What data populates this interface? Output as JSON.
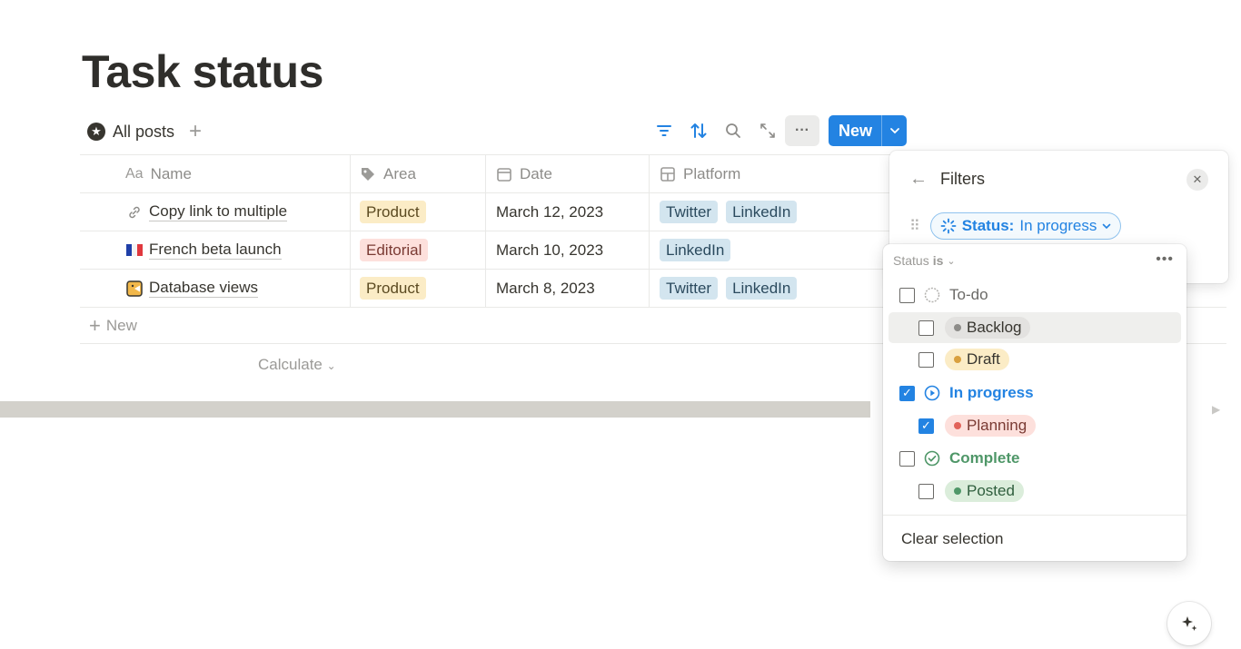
{
  "page": {
    "title": "Task status"
  },
  "view": {
    "tab_label": "All posts",
    "add_label": "+"
  },
  "toolbar": {
    "new_label": "New",
    "more_label": "···"
  },
  "table": {
    "columns": [
      {
        "icon": "text-type-icon",
        "icon_text": "Aa",
        "label": "Name"
      },
      {
        "icon": "tag-icon",
        "label": "Area"
      },
      {
        "icon": "calendar-icon",
        "label": "Date"
      },
      {
        "icon": "multi-select-icon",
        "label": "Platform"
      }
    ],
    "rows": [
      {
        "icon": "link-icon",
        "name": "Copy link to multiple",
        "area": "Product",
        "date": "March 12, 2023",
        "platforms": [
          "Twitter",
          "LinkedIn"
        ]
      },
      {
        "icon": "france-flag-icon",
        "name": "French beta launch",
        "area": "Editorial",
        "date": "March 10, 2023",
        "platforms": [
          "LinkedIn"
        ]
      },
      {
        "icon": "pacman-icon",
        "name": "Database views",
        "area": "Product",
        "date": "March 8, 2023",
        "platforms": [
          "Twitter",
          "LinkedIn"
        ]
      }
    ],
    "new_row_label": "New",
    "calculate_label": "Calculate"
  },
  "filters": {
    "title": "Filters",
    "chip_property": "Status:",
    "chip_value": "In progress"
  },
  "status_menu": {
    "header_property": "Status",
    "header_operator": "is",
    "groups": [
      {
        "label": "To-do",
        "checked": false,
        "color": "#6b6a67",
        "options": [
          {
            "label": "Backlog",
            "checked": false,
            "bg": "#e3e2e0",
            "dot": "#8d8c89"
          },
          {
            "label": "Draft",
            "checked": false,
            "bg": "#fbecc6",
            "dot": "#d9a03f"
          }
        ]
      },
      {
        "label": "In progress",
        "checked": true,
        "color": "#2383e2",
        "options": [
          {
            "label": "Planning",
            "checked": true,
            "bg": "#fde0dc",
            "dot": "#e16259"
          }
        ]
      },
      {
        "label": "Complete",
        "checked": false,
        "color": "#4f9768",
        "options": [
          {
            "label": "Posted",
            "checked": false,
            "bg": "#dbeddb",
            "dot": "#4f9768"
          }
        ]
      }
    ],
    "clear_label": "Clear selection"
  },
  "colors": {
    "accent": "#2383e2",
    "text": "#37352f",
    "muted": "#9b9a97"
  }
}
